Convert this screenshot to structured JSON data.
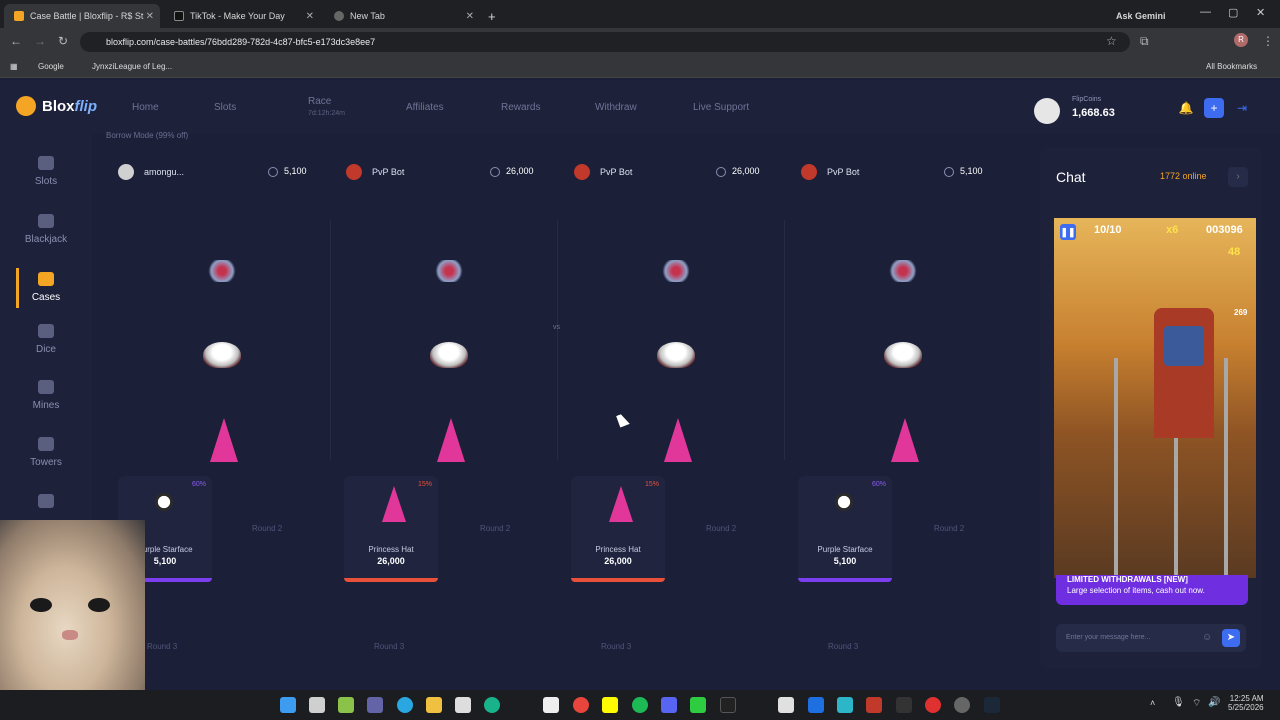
{
  "browser": {
    "tabs": [
      {
        "title": "Case Battle | Bloxflip - R$ St"
      },
      {
        "title": "TikTok - Make Your Day"
      },
      {
        "title": "New Tab"
      }
    ],
    "new_tab_symbol": "+",
    "ask_gemini": "Ask Gemini",
    "url": "bloxflip.com/case-battles/76bdd289-782d-4c87-bfc5-e173dc3e8ee7",
    "bookmarks": [
      "Google",
      "JynxziLeague of Leg..."
    ],
    "all_bookmarks": "All Bookmarks"
  },
  "header": {
    "logo_text_1": "Blox",
    "logo_text_2": "flip",
    "nav": {
      "home": "Home",
      "slots": "Slots",
      "race": "Race",
      "race_timer": "7d:12h:24m",
      "affiliates": "Affiliates",
      "rewards": "Rewards",
      "withdraw": "Withdraw",
      "live_support": "Live Support"
    },
    "flipcoins_label": "FlipCoins",
    "flipcoins_value": "1,668.63"
  },
  "sidebar": {
    "items": [
      "Slots",
      "Blackjack",
      "Cases",
      "Dice",
      "Mines",
      "Towers"
    ]
  },
  "battle": {
    "borrow_mode": "Borrow Mode (99% off)",
    "vs": "vs",
    "players": [
      {
        "name": "amongu...",
        "value": "5,100"
      },
      {
        "name": "PvP Bot",
        "value": "26,000"
      },
      {
        "name": "PvP Bot",
        "value": "26,000"
      },
      {
        "name": "PvP Bot",
        "value": "5,100"
      }
    ],
    "results": [
      {
        "name": "Purple Starface",
        "price": "5,100",
        "pct": "60%"
      },
      {
        "name": "Princess Hat",
        "price": "26,000",
        "pct": "15%"
      },
      {
        "name": "Princess Hat",
        "price": "26,000",
        "pct": "15%"
      },
      {
        "name": "Purple Starface",
        "price": "5,100",
        "pct": "60%"
      }
    ],
    "round2": "Round 2",
    "round3": "Round 3"
  },
  "chat": {
    "title": "Chat",
    "online": "1772 online",
    "video_hud": {
      "progress": "10/10",
      "multiplier": "x6",
      "score": "003096",
      "coins": "48",
      "high": "269"
    },
    "promo_title": "LIMITED WITHDRAWALS [NEW]",
    "promo_sub": "Large selection of items, cash out now.",
    "input_placeholder": "Enter your message here..."
  },
  "taskbar": {
    "time": "12:25 AM",
    "date": "5/25/2026"
  }
}
